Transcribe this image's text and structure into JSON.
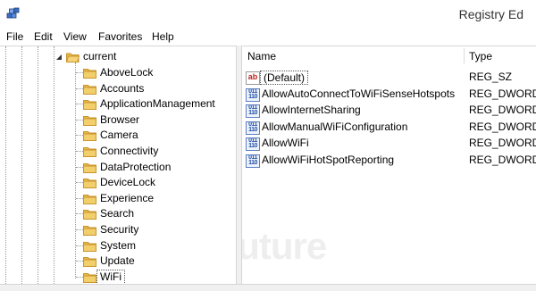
{
  "window": {
    "title": "Registry Ed",
    "icon": "registry-editor-icon"
  },
  "menu": [
    "File",
    "Edit",
    "View",
    "Favorites",
    "Help"
  ],
  "tree": {
    "parent": "current",
    "children": [
      "AboveLock",
      "Accounts",
      "ApplicationManagement",
      "Browser",
      "Camera",
      "Connectivity",
      "DataProtection",
      "DeviceLock",
      "Experience",
      "Search",
      "Security",
      "System",
      "Update",
      "WiFi"
    ],
    "selected": "WiFi"
  },
  "columns": {
    "name": "Name",
    "type": "Type"
  },
  "values": [
    {
      "name": "(Default)",
      "type": "REG_SZ",
      "icon": "string-value-icon"
    },
    {
      "name": "AllowAutoConnectToWiFiSenseHotspots",
      "type": "REG_DWORD",
      "icon": "dword-value-icon"
    },
    {
      "name": "AllowInternetSharing",
      "type": "REG_DWORD",
      "icon": "dword-value-icon"
    },
    {
      "name": "AllowManualWiFiConfiguration",
      "type": "REG_DWORD",
      "icon": "dword-value-icon"
    },
    {
      "name": "AllowWiFi",
      "type": "REG_DWORD",
      "icon": "dword-value-icon"
    },
    {
      "name": "AllowWiFiHotSpotReporting",
      "type": "REG_DWORD",
      "icon": "dword-value-icon"
    }
  ],
  "watermark": "WinFuture",
  "colors": {
    "folder": "#e8b84a",
    "folder_dark": "#c9962c",
    "string_icon": "#c02020",
    "dword_icon": "#1f4fa8"
  }
}
